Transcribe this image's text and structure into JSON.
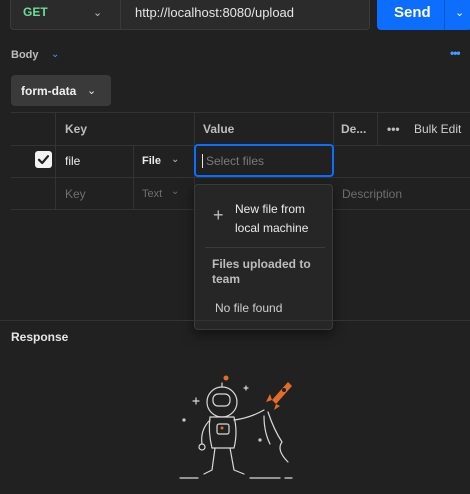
{
  "request": {
    "method": "GET",
    "url": "http://localhost:8080/upload",
    "send_label": "Send"
  },
  "body": {
    "section_label": "Body",
    "body_type": "form-data"
  },
  "table": {
    "headers": {
      "key": "Key",
      "value": "Value",
      "description": "De...",
      "bulk_edit": "Bulk Edit"
    },
    "rows": [
      {
        "checked": true,
        "key": "file",
        "type": "File",
        "value_placeholder": "Select files"
      }
    ],
    "new_row": {
      "key_placeholder": "Key",
      "type": "Text",
      "description_placeholder": "Description"
    }
  },
  "file_popup": {
    "new_file_label": "New file from local machine",
    "team_heading": "Files uploaded to team",
    "empty_text": "No file found"
  },
  "response": {
    "label": "Response"
  },
  "colors": {
    "accent": "#0d6efd",
    "method_get": "#6bdd9a",
    "rocket": "#e36c2a"
  }
}
